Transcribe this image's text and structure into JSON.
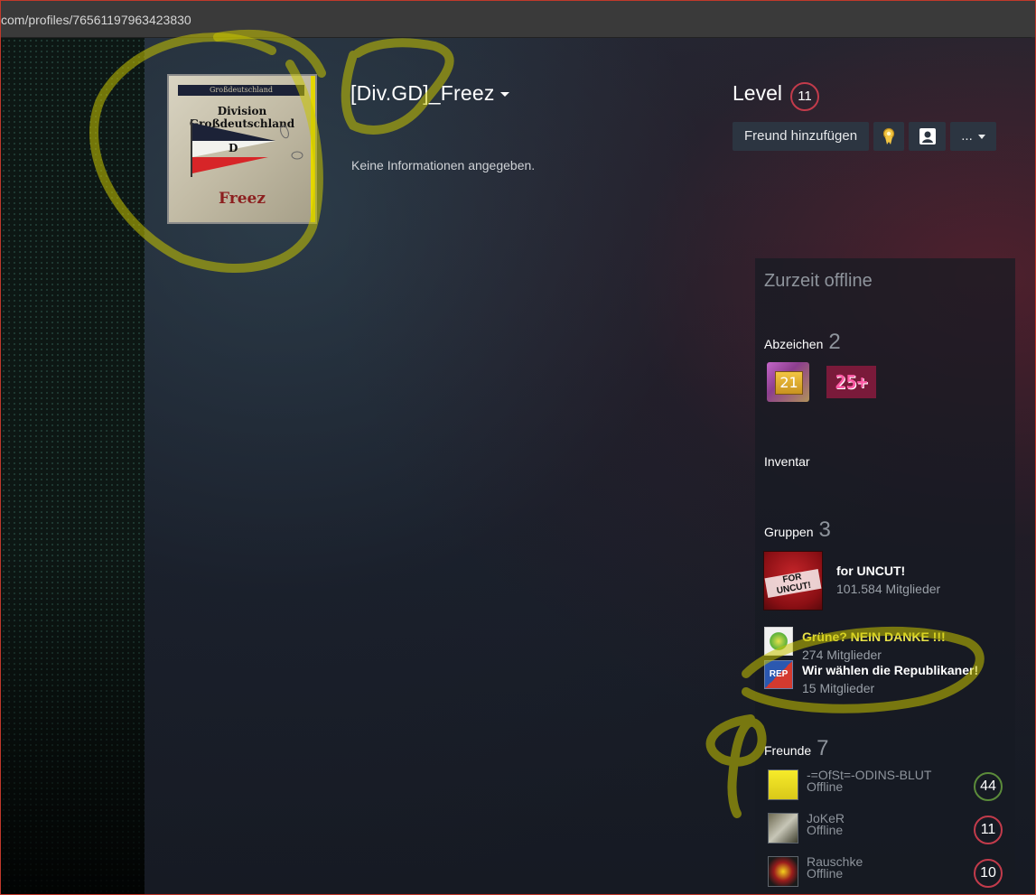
{
  "browser": {
    "url": "com/profiles/76561197963423830"
  },
  "profile": {
    "avatar": {
      "band_text": "Großdeutschland",
      "division_text": "Division Großdeutschland",
      "name_text": "Freez"
    },
    "persona_name": "[Div.GD]_Freez",
    "summary": "Keine Informationen angegeben.",
    "level_label": "Level",
    "level_value": "11",
    "buttons": {
      "add_friend": "Freund hinzufügen",
      "award_icon": "award-ribbon-icon",
      "profile_icon": "person-card-icon",
      "more": "..."
    }
  },
  "sidebar": {
    "status": "Zurzeit offline",
    "badges": {
      "title": "Abzeichen",
      "count": "2",
      "items": [
        {
          "label": "21",
          "icon": "years-of-service-badge-icon"
        },
        {
          "label": "25+",
          "icon": "game-collector-badge-icon"
        }
      ]
    },
    "inventory": {
      "title": "Inventar"
    },
    "groups": {
      "title": "Gruppen",
      "count": "3",
      "items": [
        {
          "name": "for UNCUT!",
          "members": "101.584 Mitglieder",
          "avatar_text": "FOR UNCUT!"
        },
        {
          "name": "Grüne? NEIN DANKE !!!",
          "members": "274 Mitglieder"
        },
        {
          "name": "Wir wählen die Republikaner!",
          "members": "15 Mitglieder",
          "avatar_text": "REP"
        }
      ]
    },
    "friends": {
      "title": "Freunde",
      "count": "7",
      "items": [
        {
          "name": "-=OfSt=-ODINS-BLUT",
          "status": "Offline",
          "level": "44"
        },
        {
          "name": "JoKeR",
          "status": "Offline",
          "level": "11"
        },
        {
          "name": "Rauschke",
          "status": "Offline",
          "level": "10"
        }
      ]
    }
  },
  "colors": {
    "level_ring_red": "#c23b4b",
    "level_ring_green": "#5b8b3a",
    "button_bg": "#2c3541",
    "annotation_yellow": "#c8c400"
  }
}
